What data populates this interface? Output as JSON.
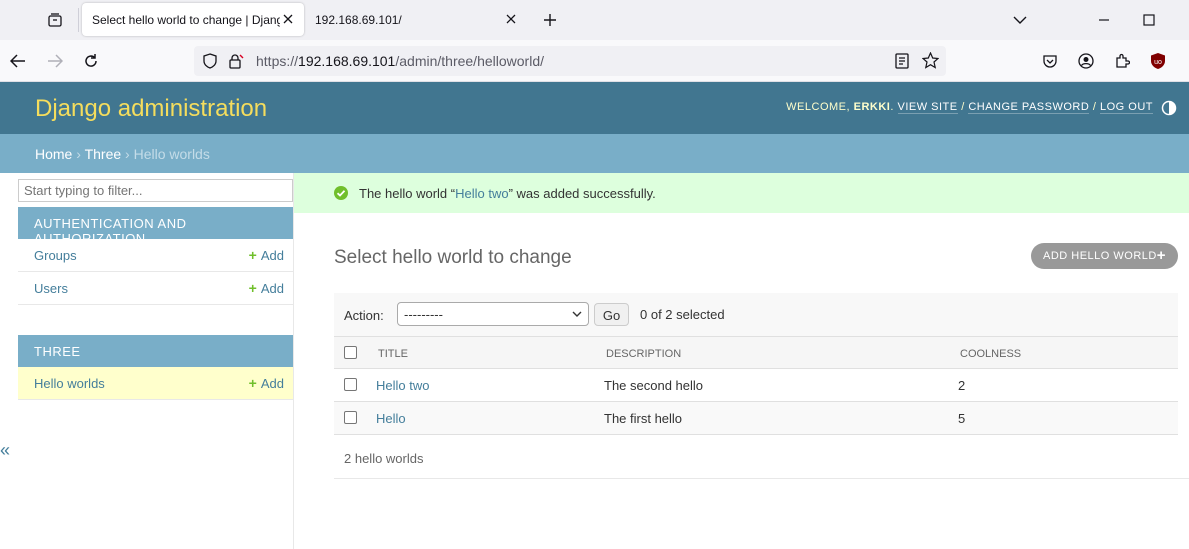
{
  "browser": {
    "active_tab_title": "Select hello world to change | Django site admin",
    "inactive_tab_title": "192.168.69.101/",
    "url_prefix": "https://",
    "url_host": "192.168.69.101",
    "url_path": "/admin/three/helloworld/"
  },
  "header": {
    "branding": "Django administration",
    "welcome": "Welcome,",
    "username": "erkki",
    "view_site": "View site",
    "change_password": "Change password",
    "log_out": "Log out",
    "sep": "/"
  },
  "breadcrumbs": {
    "home": "Home",
    "app": "Three",
    "current": "Hello worlds",
    "sep": "›"
  },
  "sidebar": {
    "filter_placeholder": "Start typing to filter...",
    "modules": [
      {
        "caption": "Authentication and Authorization",
        "models": [
          {
            "name": "Groups",
            "add": "Add"
          },
          {
            "name": "Users",
            "add": "Add"
          }
        ]
      },
      {
        "caption": "Three",
        "models": [
          {
            "name": "Hello worlds",
            "add": "Add"
          }
        ]
      }
    ],
    "collapse_label": "«"
  },
  "message": {
    "before": "The hello world “",
    "object_link": "Hello two",
    "after": "” was added successfully."
  },
  "content": {
    "title": "Select hello world to change",
    "add_button": "Add hello world",
    "action_label": "Action:",
    "action_selected": "---------",
    "go_button": "Go",
    "selection_count": "0 of 2 selected",
    "columns": [
      "Title",
      "Description",
      "Coolness"
    ],
    "rows": [
      {
        "title": "Hello two",
        "description": "The second hello",
        "coolness": "2"
      },
      {
        "title": "Hello",
        "description": "The first hello",
        "coolness": "5"
      }
    ],
    "paginator": "2 hello worlds"
  }
}
